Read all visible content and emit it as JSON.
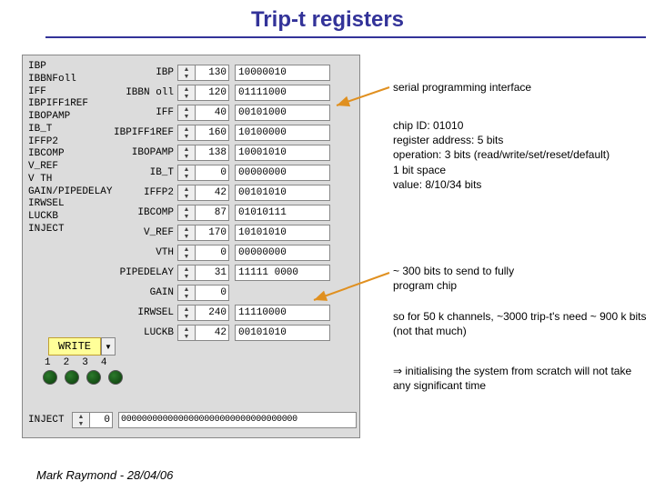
{
  "title": "Trip-t registers",
  "footer": "Mark Raymond - 28/04/06",
  "sidebar": [
    "IBP",
    "IBBNFoll",
    "IFF",
    "IBPIFF1REF",
    "IBOPAMP",
    "IB_T",
    "IFFP2",
    "IBCOMP",
    "V_REF",
    "V TH",
    "GAIN/PIPEDELAY",
    "IRWSEL",
    "LUCKB",
    "INJECT"
  ],
  "registers": [
    {
      "label": "IBP",
      "value": "130",
      "bits": "10000010"
    },
    {
      "label": "IBBN oll",
      "value": "120",
      "bits": "01111000"
    },
    {
      "label": "IFF",
      "value": "40",
      "bits": "00101000"
    },
    {
      "label": "IBPIFF1REF",
      "value": "160",
      "bits": "10100000"
    },
    {
      "label": "IBOPAMP",
      "value": "138",
      "bits": "10001010"
    },
    {
      "label": "IB_T",
      "value": "0",
      "bits": "00000000"
    },
    {
      "label": "IFFP2",
      "value": "42",
      "bits": "00101010"
    },
    {
      "label": "IBCOMP",
      "value": "87",
      "bits": "01010111"
    },
    {
      "label": "V_REF",
      "value": "170",
      "bits": "10101010"
    },
    {
      "label": "VTH",
      "value": "0",
      "bits": "00000000"
    },
    {
      "label": "PIPEDELAY",
      "value": "31",
      "bits": "11111 0000"
    },
    {
      "label": "GAIN",
      "value": "0",
      "bits": ""
    },
    {
      "label": "IRWSEL",
      "value": "240",
      "bits": "11110000"
    },
    {
      "label": "LUCKB",
      "value": "42",
      "bits": "00101010"
    }
  ],
  "inject": {
    "label": "INJECT",
    "value": "0",
    "bits": "0000000000000000000000000000000000"
  },
  "write_label": "WRITE",
  "channels": [
    "1",
    "2",
    "3",
    "4"
  ],
  "annotations": {
    "a1": "serial programming interface",
    "a2": "chip ID: 01010\nregister address: 5 bits\noperation: 3 bits (read/write/set/reset/default)\n1 bit space\nvalue: 8/10/34 bits",
    "a3": "~ 300 bits to send to fully\nprogram chip",
    "a4": "so for 50 k channels, ~3000 trip-t's need ~ 900 k bits (not that much)",
    "a5_prefix": "⇒ ",
    "a5": "initialising the system from scratch will not take any significant time"
  }
}
